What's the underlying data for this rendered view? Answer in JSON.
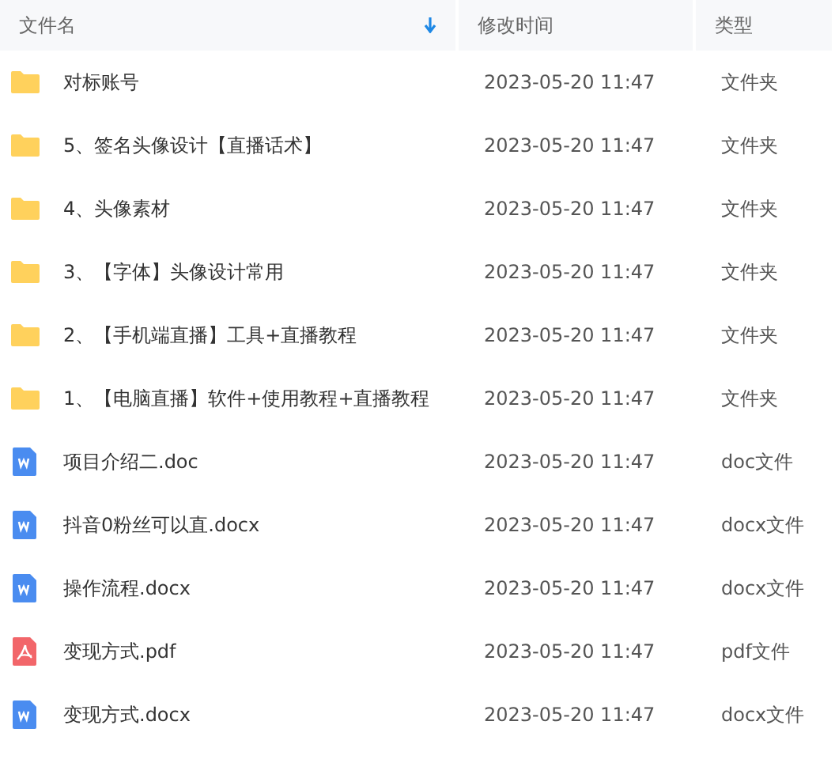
{
  "columns": [
    {
      "label": "文件名",
      "sorted": true
    },
    {
      "label": "修改时间",
      "sorted": false
    },
    {
      "label": "类型",
      "sorted": false
    }
  ],
  "rows": [
    {
      "kind": "folder",
      "name": "对标账号",
      "modified": "2023-05-20 11:47",
      "type": "文件夹"
    },
    {
      "kind": "folder",
      "name": "5、签名头像设计【直播话术】",
      "modified": "2023-05-20 11:47",
      "type": "文件夹"
    },
    {
      "kind": "folder",
      "name": "4、头像素材",
      "modified": "2023-05-20 11:47",
      "type": "文件夹"
    },
    {
      "kind": "folder",
      "name": "3、【字体】头像设计常用",
      "modified": "2023-05-20 11:47",
      "type": "文件夹"
    },
    {
      "kind": "folder",
      "name": "2、【手机端直播】工具+直播教程",
      "modified": "2023-05-20 11:47",
      "type": "文件夹"
    },
    {
      "kind": "folder",
      "name": "1、【电脑直播】软件+使用教程+直播教程",
      "modified": "2023-05-20 11:47",
      "type": "文件夹"
    },
    {
      "kind": "word",
      "name": "项目介绍二.doc",
      "modified": "2023-05-20 11:47",
      "type": "doc文件"
    },
    {
      "kind": "word",
      "name": "抖音0粉丝可以直.docx",
      "modified": "2023-05-20 11:47",
      "type": "docx文件"
    },
    {
      "kind": "word",
      "name": "操作流程.docx",
      "modified": "2023-05-20 11:47",
      "type": "docx文件"
    },
    {
      "kind": "pdf",
      "name": "变现方式.pdf",
      "modified": "2023-05-20 11:47",
      "type": "pdf文件"
    },
    {
      "kind": "word",
      "name": "变现方式.docx",
      "modified": "2023-05-20 11:47",
      "type": "docx文件"
    }
  ]
}
